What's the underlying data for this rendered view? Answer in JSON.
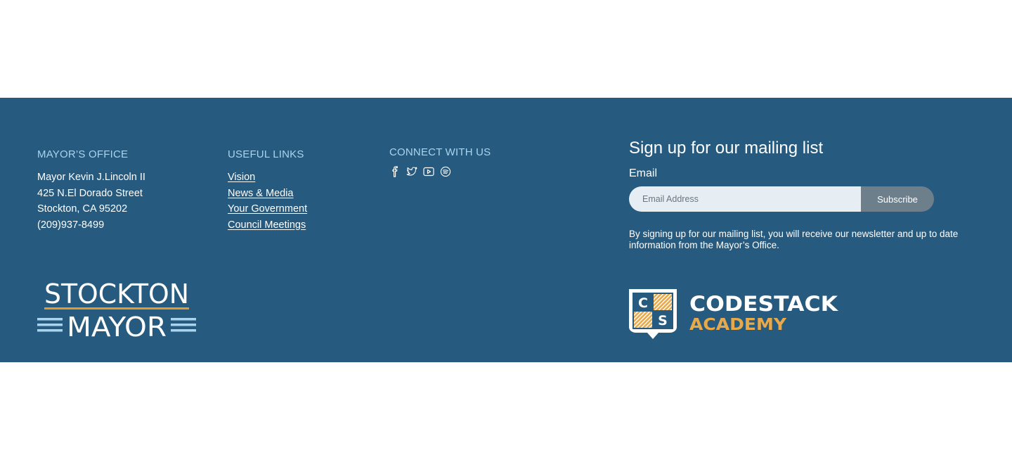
{
  "office": {
    "heading": "MAYOR’S OFFICE",
    "lines": [
      "Mayor Kevin J.Lincoln II",
      "425 N.El Dorado Street",
      "Stockton, CA 95202",
      "(209)937-8499"
    ]
  },
  "useful_links": {
    "heading": "USEFUL LINKS",
    "items": [
      "Vision",
      "News & Media",
      "Your Government",
      "Council Meetings"
    ]
  },
  "connect": {
    "heading": "CONNECT WITH US",
    "icons": [
      "facebook-icon",
      "twitter-icon",
      "youtube-icon",
      "spotify-icon"
    ]
  },
  "signup": {
    "title": "Sign up for our mailing list",
    "email_label": "Email",
    "placeholder": "Email Address",
    "button": "Subscribe",
    "note": "By signing up for our mailing list, you will receive our newsletter and up to date information from the Mayor’s Office."
  },
  "logos": {
    "stockton_top": "STOCKTON",
    "stockton_bottom": "MAYOR",
    "codestack_c": "C",
    "codestack_s": "S",
    "codestack_top": "CODESTACK",
    "codestack_bottom": "ACADEMY"
  },
  "colors": {
    "footer_bg": "#265A7E",
    "heading": "#A8D4F0",
    "accent_orange": "#E39B2E",
    "stripe_light": "#A8D4F0"
  }
}
